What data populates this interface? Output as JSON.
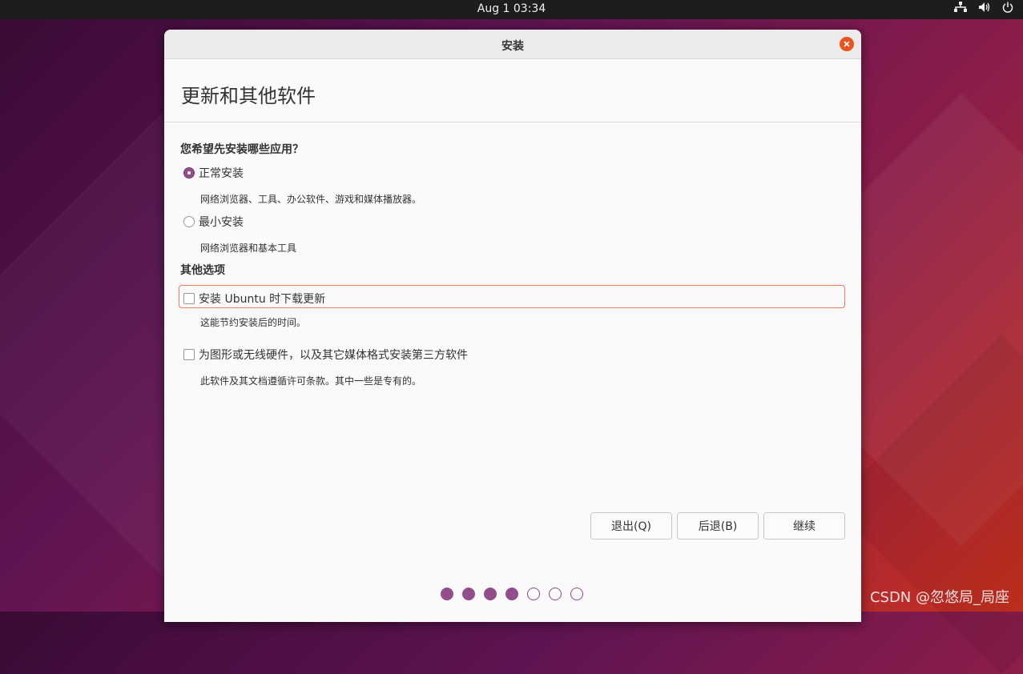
{
  "topbar": {
    "clock": "Aug 1  03:34",
    "icons": [
      "network-icon",
      "volume-icon",
      "power-icon"
    ]
  },
  "window": {
    "title": "安装",
    "page_title": "更新和其他软件"
  },
  "install_type": {
    "question": "您希望先安装哪些应用？",
    "options": [
      {
        "label": "正常安装",
        "description": "网络浏览器、工具、办公软件、游戏和媒体播放器。",
        "selected": true
      },
      {
        "label": "最小安装",
        "description": "网络浏览器和基本工具",
        "selected": false
      }
    ]
  },
  "other_options": {
    "heading": "其他选项",
    "items": [
      {
        "label": "安装 Ubuntu 时下载更新",
        "description": "这能节约安装后的时间。",
        "checked": false
      },
      {
        "label": "为图形或无线硬件，以及其它媒体格式安装第三方软件",
        "description": "此软件及其文档遵循许可条款。其中一些是专有的。",
        "checked": false
      }
    ]
  },
  "buttons": {
    "quit": "退出(Q)",
    "back": "后退(B)",
    "continue": "继续"
  },
  "progress": {
    "completed_steps": 4,
    "total_steps": 7
  },
  "watermark": "CSDN @忽悠局_局座",
  "colors": {
    "accent": "#e95420",
    "aubergine": "#924d8b",
    "topbar": "#1d1d1d"
  }
}
